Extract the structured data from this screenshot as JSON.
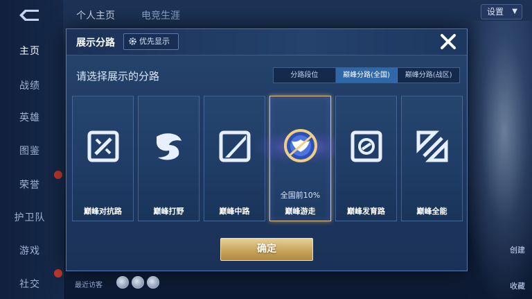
{
  "background": {
    "top_tabs": [
      "个人主页",
      "电竞生涯"
    ],
    "settings_label": "设置",
    "nav_items": [
      {
        "label": "主页",
        "active": true
      },
      {
        "label": "战绩",
        "active": false
      },
      {
        "label": "英雄",
        "active": false
      },
      {
        "label": "图鉴",
        "active": false
      },
      {
        "label": "荣誉",
        "active": false
      },
      {
        "label": "护卫队",
        "active": false
      },
      {
        "label": "游戏",
        "active": false
      },
      {
        "label": "社交",
        "active": false
      }
    ],
    "recent_visitors_label": "最近访客",
    "right_labels": [
      "创建",
      "收藏"
    ]
  },
  "modal": {
    "title": "展示分路",
    "priority_button_label": "优先显示",
    "subtitle": "请选择展示的分路",
    "segments": [
      {
        "label": "分路段位",
        "active": false
      },
      {
        "label": "巅峰分路(全国)",
        "active": true
      },
      {
        "label": "巅峰分路(战区)",
        "active": false
      }
    ],
    "lanes": [
      {
        "label": "巅峰对抗路",
        "icon": "sword-lane-icon",
        "selected": false,
        "rank": ""
      },
      {
        "label": "巅峰打野",
        "icon": "dragon-jungle-icon",
        "selected": false,
        "rank": ""
      },
      {
        "label": "巅峰中路",
        "icon": "blade-mid-icon",
        "selected": false,
        "rank": ""
      },
      {
        "label": "巅峰游走",
        "icon": "wings-support-emblem-icon",
        "selected": true,
        "rank": "全国前10%"
      },
      {
        "label": "巅峰发育路",
        "icon": "target-adc-icon",
        "selected": false,
        "rank": ""
      },
      {
        "label": "巅峰全能",
        "icon": "allround-icon",
        "selected": false,
        "rank": ""
      }
    ],
    "confirm_label": "确定"
  },
  "colors": {
    "accent_gold": "#e6c27a",
    "active_tab": "#2f68a8",
    "modal_bg": "#1f3a63"
  }
}
